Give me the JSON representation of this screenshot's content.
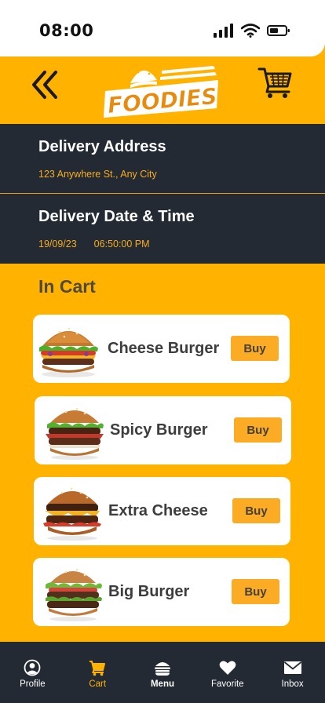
{
  "status_bar": {
    "time": "08:00"
  },
  "header": {
    "logo_text": "FOODIES"
  },
  "delivery_address": {
    "title": "Delivery Address",
    "address": "123 Anywhere St., Any City"
  },
  "delivery_datetime": {
    "title": "Delivery Date & Time",
    "date": "19/09/23",
    "time": "06:50:00 PM"
  },
  "cart": {
    "title": "In Cart",
    "items": [
      {
        "name": "Cheese Burger",
        "buy_label": "Buy"
      },
      {
        "name": "Spicy Burger",
        "buy_label": "Buy"
      },
      {
        "name": "Extra Cheese",
        "buy_label": "Buy"
      },
      {
        "name": "Big Burger",
        "buy_label": "Buy"
      }
    ]
  },
  "bottom_nav": {
    "items": [
      {
        "label": "Profile",
        "icon": "profile-icon"
      },
      {
        "label": "Cart",
        "icon": "cart-icon"
      },
      {
        "label": "Menu",
        "icon": "burger-icon"
      },
      {
        "label": "Favorite",
        "icon": "heart-icon"
      },
      {
        "label": "Inbox",
        "icon": "mail-icon"
      }
    ],
    "active_index": 1
  },
  "colors": {
    "brand_orange": "#ffb300",
    "panel_dark": "#232a34",
    "accent_text": "#f6ad1d",
    "buy_button": "#fcab25"
  }
}
